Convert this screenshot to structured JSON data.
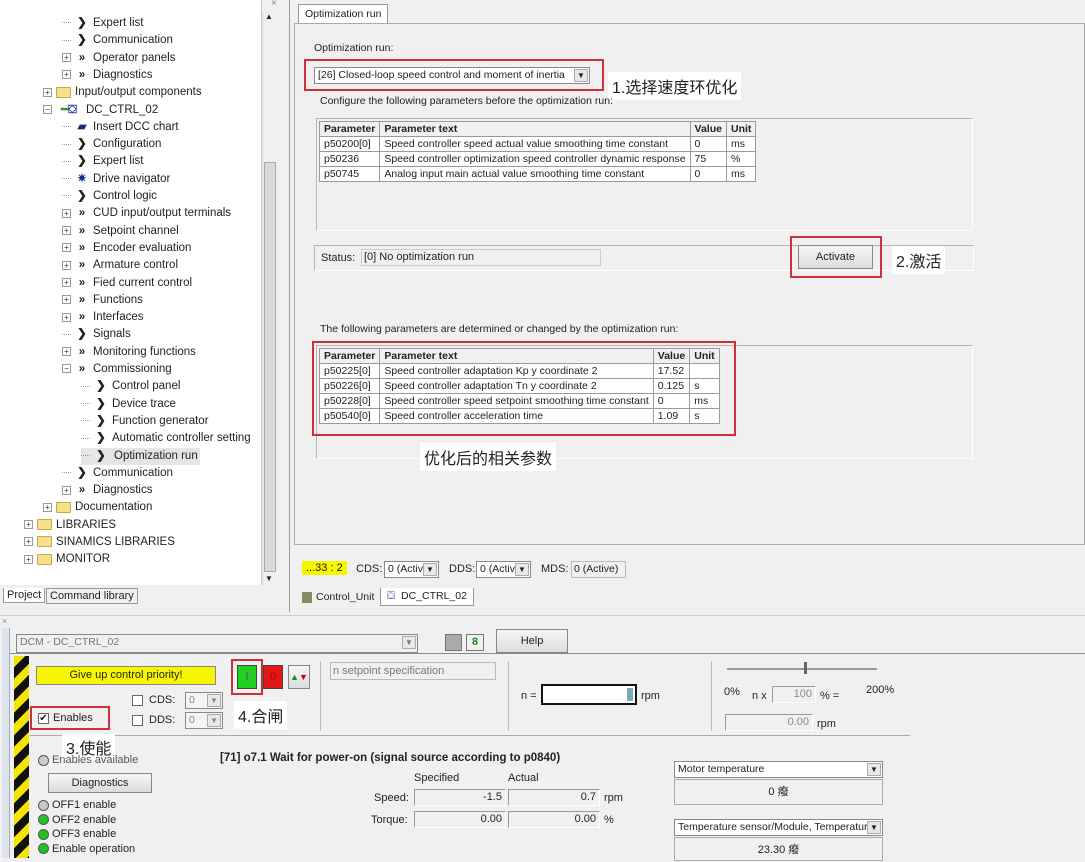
{
  "tree": {
    "items": [
      {
        "label": "Expert list",
        "level": 3,
        "exp": "",
        "icon": "single"
      },
      {
        "label": "Communication",
        "level": 3,
        "exp": "",
        "icon": "single"
      },
      {
        "label": "Operator panels",
        "level": 3,
        "exp": "plus",
        "icon": "double"
      },
      {
        "label": "Diagnostics",
        "level": 3,
        "exp": "plus",
        "icon": "double"
      },
      {
        "label": "Input/output components",
        "level": 2,
        "exp": "plus",
        "icon": "folder"
      },
      {
        "label": "DC_CTRL_02",
        "level": 2,
        "exp": "minus",
        "icon": "drive"
      },
      {
        "label": "Insert DCC chart",
        "level": 3,
        "exp": "",
        "icon": "dcc"
      },
      {
        "label": "Configuration",
        "level": 3,
        "exp": "",
        "icon": "single"
      },
      {
        "label": "Expert list",
        "level": 3,
        "exp": "",
        "icon": "single"
      },
      {
        "label": "Drive navigator",
        "level": 3,
        "exp": "",
        "icon": "navigator"
      },
      {
        "label": "Control logic",
        "level": 3,
        "exp": "",
        "icon": "single"
      },
      {
        "label": "CUD  input/output  terminals",
        "level": 3,
        "exp": "plus",
        "icon": "double"
      },
      {
        "label": "Setpoint channel",
        "level": 3,
        "exp": "plus",
        "icon": "double"
      },
      {
        "label": "Encoder evaluation",
        "level": 3,
        "exp": "plus",
        "icon": "double"
      },
      {
        "label": "Armature control",
        "level": 3,
        "exp": "plus",
        "icon": "double"
      },
      {
        "label": "Fied current control",
        "level": 3,
        "exp": "plus",
        "icon": "double"
      },
      {
        "label": "Functions",
        "level": 3,
        "exp": "plus",
        "icon": "double"
      },
      {
        "label": "Interfaces",
        "level": 3,
        "exp": "plus",
        "icon": "double"
      },
      {
        "label": "Signals",
        "level": 3,
        "exp": "",
        "icon": "single"
      },
      {
        "label": "Monitoring functions",
        "level": 3,
        "exp": "plus",
        "icon": "double"
      },
      {
        "label": "Commissioning",
        "level": 3,
        "exp": "minus",
        "icon": "double"
      },
      {
        "label": "Control panel",
        "level": 4,
        "exp": "",
        "icon": "single"
      },
      {
        "label": "Device trace",
        "level": 4,
        "exp": "",
        "icon": "single"
      },
      {
        "label": "Function generator",
        "level": 4,
        "exp": "",
        "icon": "single"
      },
      {
        "label": "Automatic controller setting",
        "level": 4,
        "exp": "",
        "icon": "single"
      },
      {
        "label": "Optimization run",
        "level": 4,
        "exp": "",
        "icon": "single",
        "selected": true
      },
      {
        "label": "Communication",
        "level": 3,
        "exp": "",
        "icon": "single"
      },
      {
        "label": "Diagnostics",
        "level": 3,
        "exp": "plus",
        "icon": "double"
      },
      {
        "label": "Documentation",
        "level": 2,
        "exp": "plus",
        "icon": "folder"
      },
      {
        "label": "LIBRARIES",
        "level": 1,
        "exp": "plus",
        "icon": "folder"
      },
      {
        "label": "SINAMICS LIBRARIES",
        "level": 1,
        "exp": "plus",
        "icon": "folder"
      },
      {
        "label": "MONITOR",
        "level": 1,
        "exp": "plus",
        "icon": "folder"
      }
    ]
  },
  "left_tabs": [
    "Project",
    "Command library"
  ],
  "main": {
    "tab": "Optimization run",
    "opt_label": "Optimization run:",
    "opt_value": "[26] Closed-loop speed control and moment of inertia",
    "annot1": "1.选择速度环优化",
    "config_label": "Configure the following parameters before the optimization run:",
    "headers": [
      "Parameter",
      "Parameter text",
      "Value",
      "Unit"
    ],
    "config_rows": [
      [
        "p50200[0]",
        "Speed controller speed actual value smoothing time constant",
        "0",
        "ms"
      ],
      [
        "p50236",
        "Speed controller optimization speed controller dynamic response",
        "75",
        "%"
      ],
      [
        "p50745",
        "Analog input main actual value smoothing time constant",
        "0",
        "ms"
      ]
    ],
    "status_label": "Status:",
    "status_value": "[0] No optimization run",
    "activate": "Activate",
    "annot2": "2.激活",
    "result_label": "The following parameters are determined or changed by the optimization run:",
    "result_rows": [
      [
        "p50225[0]",
        "Speed controller adaptation Kp y coordinate 2",
        "17.52",
        ""
      ],
      [
        "p50226[0]",
        "Speed controller adaptation Tn y coordinate 2",
        "0.125",
        "s"
      ],
      [
        "p50228[0]",
        "Speed controller speed setpoint smoothing time constant",
        "0",
        "ms"
      ],
      [
        "p50540[0]",
        "Speed controller acceleration time",
        "1.09",
        "s"
      ]
    ],
    "annot_result": "优化后的相关参数"
  },
  "statusbar": {
    "pos": "...33 : 2",
    "cds_label": "CDS:",
    "cds": "0 (Activ",
    "dds_label": "DDS:",
    "dds": "0 (Activ",
    "mds_label": "MDS:",
    "mds": "0 (Active)"
  },
  "doc_tabs": [
    "Control_Unit",
    "DC_CTRL_02"
  ],
  "panel": {
    "drive": "DCM - DC_CTRL_02",
    "help": "Help",
    "give_up": "Give up control priority!",
    "on": "I",
    "off": "0",
    "cds_label": "CDS:",
    "cds": "0",
    "dds_label": "DDS:",
    "dds": "0",
    "enables": "Enables",
    "annot3": "3.使能",
    "annot4": "4.合闸",
    "setpoint_spec": "n setpoint specification",
    "n_label": "n =",
    "rpm": "rpm",
    "slider_min": "0%",
    "slider_max": "200%",
    "slider_value": 100,
    "nx_label": "n x",
    "nx_value": "100",
    "pct_eq": "% =",
    "result_value": "0.00",
    "enables_available": "Enables available",
    "diagnostics": "Diagnostics",
    "status_msg": "[71] o7.1 Wait for power-on (signal source according to p0840)",
    "specified": "Specified",
    "actual": "Actual",
    "speed_label": "Speed:",
    "speed_spec": "-1.5",
    "speed_act": "0.7",
    "torque_label": "Torque:",
    "torque_spec": "0.00",
    "torque_act": "0.00",
    "pct": "%",
    "leds": [
      {
        "label": "OFF1 enable",
        "color": "#c8c8c8"
      },
      {
        "label": "OFF2 enable",
        "color": "#22c422"
      },
      {
        "label": "OFF3 enable",
        "color": "#22c422"
      },
      {
        "label": "Enable operation",
        "color": "#22c422"
      }
    ],
    "temp1_sel": "Motor temperature",
    "temp1_val": "0 癈",
    "temp2_sel": "Temperature sensor/Module, Temperatur",
    "temp2_val": "23.30 癈"
  },
  "colors": {
    "highlight": "#c8323a",
    "yellow": "#f6f600",
    "on_green": "#22d022",
    "off_red": "#e01818"
  }
}
